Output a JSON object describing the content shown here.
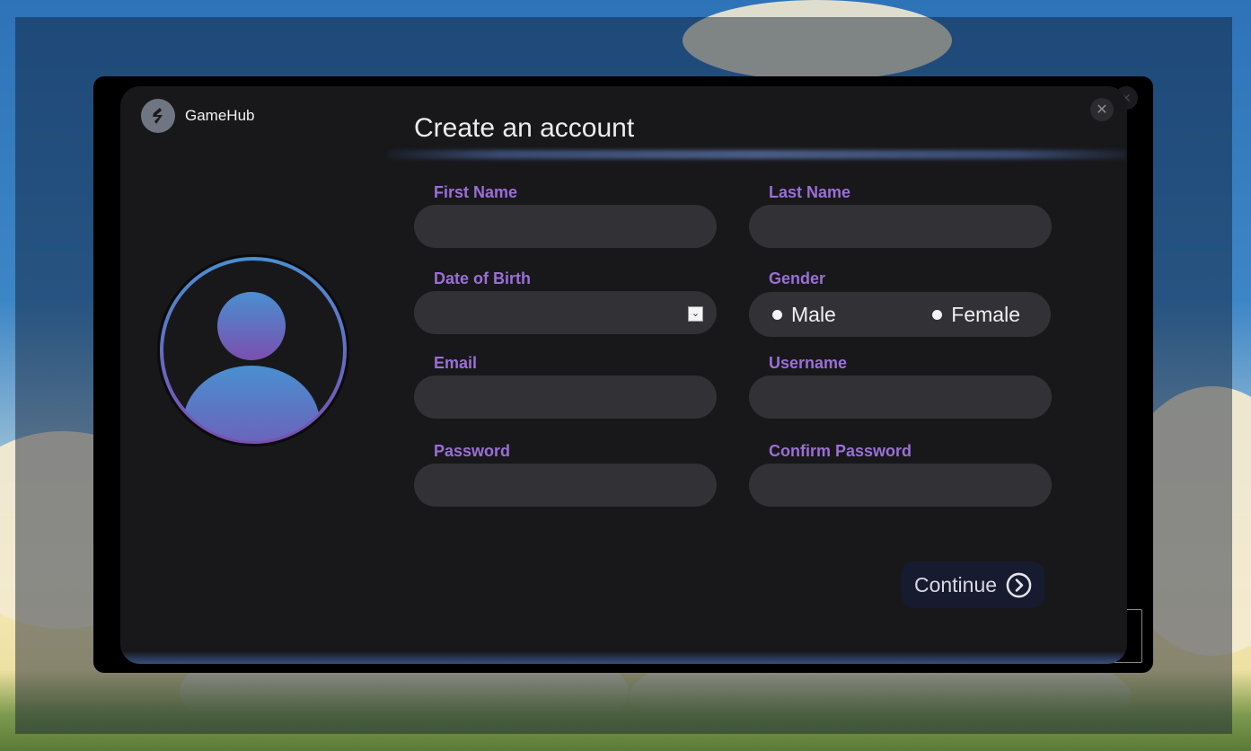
{
  "app": {
    "brand_name": "GameHub"
  },
  "dialog": {
    "title": "Create an account",
    "close_icon": "close-icon"
  },
  "form": {
    "first_name": {
      "label": "First Name",
      "value": ""
    },
    "last_name": {
      "label": "Last Name",
      "value": ""
    },
    "dob": {
      "label": "Date of Birth",
      "value": ""
    },
    "gender": {
      "label": "Gender",
      "options": [
        "Male",
        "Female"
      ]
    },
    "email": {
      "label": "Email",
      "value": ""
    },
    "username": {
      "label": "Username",
      "value": ""
    },
    "password": {
      "label": "Password",
      "value": ""
    },
    "confirm_password": {
      "label": "Confirm Password",
      "value": ""
    }
  },
  "actions": {
    "continue_label": "Continue"
  },
  "colors": {
    "label_accent": "#9b6fd6",
    "dialog_bg": "#18181b",
    "input_bg": "#313136",
    "avatar_gradient_top": "#4a8fd0",
    "avatar_gradient_bottom": "#7a4fb0"
  }
}
